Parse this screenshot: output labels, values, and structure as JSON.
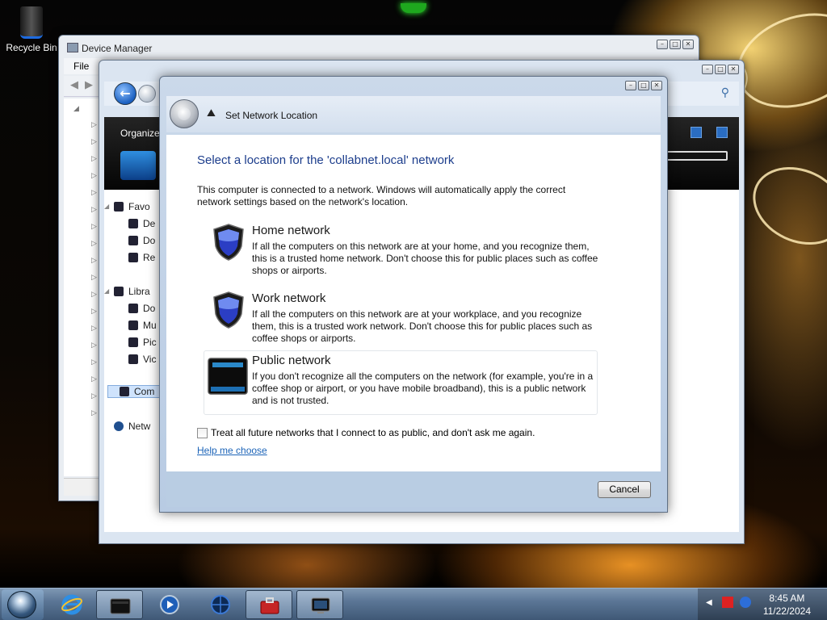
{
  "desktop": {
    "icons": [
      {
        "label": "Recycle Bin",
        "icon": "recycle-bin-icon"
      }
    ]
  },
  "device_manager": {
    "title": "Device Manager",
    "menu": [
      "File"
    ],
    "caption_buttons": [
      "minimize",
      "maximize",
      "close"
    ]
  },
  "explorer": {
    "toolbar_label": "Organize",
    "nav": [
      {
        "label": "Favo",
        "icon": "star-icon"
      },
      {
        "label": "De",
        "icon": "desktop-icon"
      },
      {
        "label": "Do",
        "icon": "downloads-icon"
      },
      {
        "label": "Re",
        "icon": "recent-places-icon"
      },
      {
        "label": "Libra",
        "icon": "libraries-icon"
      },
      {
        "label": "Do",
        "icon": "documents-icon"
      },
      {
        "label": "Mu",
        "icon": "music-icon"
      },
      {
        "label": "Pic",
        "icon": "pictures-icon"
      },
      {
        "label": "Vic",
        "icon": "videos-icon"
      },
      {
        "label": "Com",
        "icon": "computer-icon"
      },
      {
        "label": "Netw",
        "icon": "network-icon"
      }
    ]
  },
  "dialog": {
    "title": "Set Network Location",
    "heading": "Select a location for the 'collabnet.local' network",
    "intro": "This computer is connected to a network. Windows will automatically apply the correct network settings based on the network's location.",
    "options": [
      {
        "title": "Home network",
        "description": "If all the computers on this network are at your home, and you recognize them, this is a trusted home network.  Don't choose this for public places such as coffee shops or airports.",
        "icon": "home-network-shield-icon"
      },
      {
        "title": "Work network",
        "description": "If all the computers on this network are at your workplace, and you recognize them, this is a trusted work network.  Don't choose this for public places such as coffee shops or airports.",
        "icon": "work-network-shield-icon"
      },
      {
        "title": "Public network",
        "description": "If you don't recognize all the computers on the network (for example, you're in a coffee shop or airport, or you have mobile broadband), this is a public network and is not trusted.",
        "icon": "public-network-bench-icon"
      }
    ],
    "checkbox_label": "Treat all future networks that I connect to as public, and don't ask me again.",
    "checkbox_checked": false,
    "help_link": "Help me choose",
    "cancel_label": "Cancel"
  },
  "taskbar": {
    "pinned": [
      {
        "name": "internet-explorer",
        "icon": "internet-explorer-icon"
      },
      {
        "name": "explorer",
        "icon": "folder-icon"
      },
      {
        "name": "media-player",
        "icon": "media-player-icon"
      },
      {
        "name": "network",
        "icon": "globe-icon"
      },
      {
        "name": "toolbox",
        "icon": "toolbox-icon"
      },
      {
        "name": "device-manager",
        "icon": "device-manager-icon"
      }
    ],
    "clock": {
      "time": "8:45 AM",
      "date": "11/22/2024"
    }
  },
  "colors": {
    "heading": "#1c3d8c",
    "link": "#1c64b8",
    "taskbar": "#5b7696",
    "dialog_frame": "#b8cbe3"
  }
}
